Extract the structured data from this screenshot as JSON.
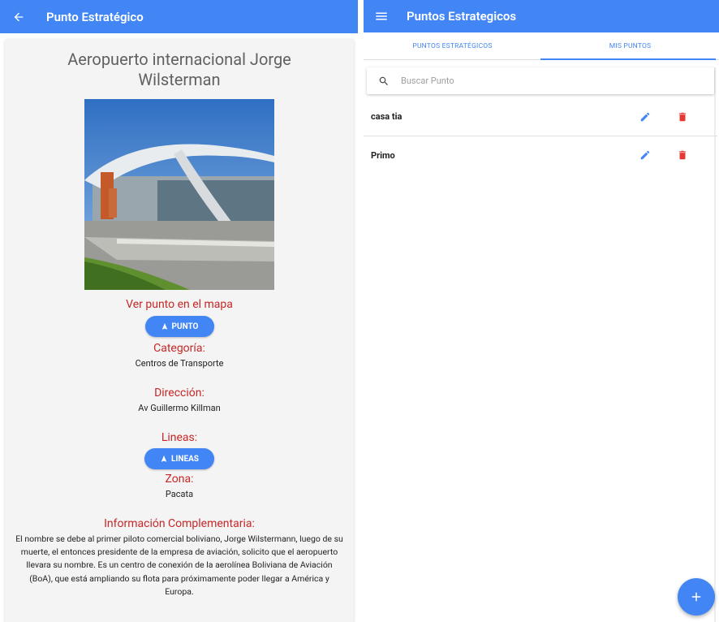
{
  "detail": {
    "header_title": "Punto Estratégico",
    "place_name": "Aeropuerto internacional Jorge Wilsterman",
    "map_label": "Ver punto en el mapa",
    "map_button": "PUNTO",
    "category_label": "Categoría:",
    "category_value": "Centros de Transporte",
    "address_label": "Dirección:",
    "address_value": "Av Guillermo Killman",
    "lines_label": "Lineas:",
    "lines_button": "LINEAS",
    "zone_label": "Zona:",
    "zone_value": "Pacata",
    "info_label": "Información Complementaria:",
    "info_text": "El nombre se debe al primer piloto comercial boliviano, Jorge Wilstermann, luego de su muerte, el entonces presidente de la empresa de aviación, solicito que el aeropuerto llevara su nombre. Es un centro de conexión de la aerolínea Boliviana de Aviación (BoA), que está ampliando su flota para próximamente poder llegar a América y Europa."
  },
  "list_screen": {
    "header_title": "Puntos Estrategicos",
    "tabs": [
      {
        "label": "PUNTOS ESTRATÉGICOS",
        "selected": false
      },
      {
        "label": "MIS PUNTOS",
        "selected": true
      }
    ],
    "search_placeholder": "Buscar Punto",
    "items": [
      {
        "name": "casa tia"
      },
      {
        "name": "Primo"
      }
    ]
  },
  "colors": {
    "primary": "#4285f4",
    "accent_red": "#c62828",
    "delete_red": "#e53935"
  },
  "icons": {
    "back": "arrow-left-icon",
    "menu": "hamburger-menu-icon",
    "navigation": "navigation-arrow-icon",
    "search": "search-icon",
    "edit": "pencil-icon",
    "delete": "trash-icon",
    "add": "plus-icon"
  }
}
